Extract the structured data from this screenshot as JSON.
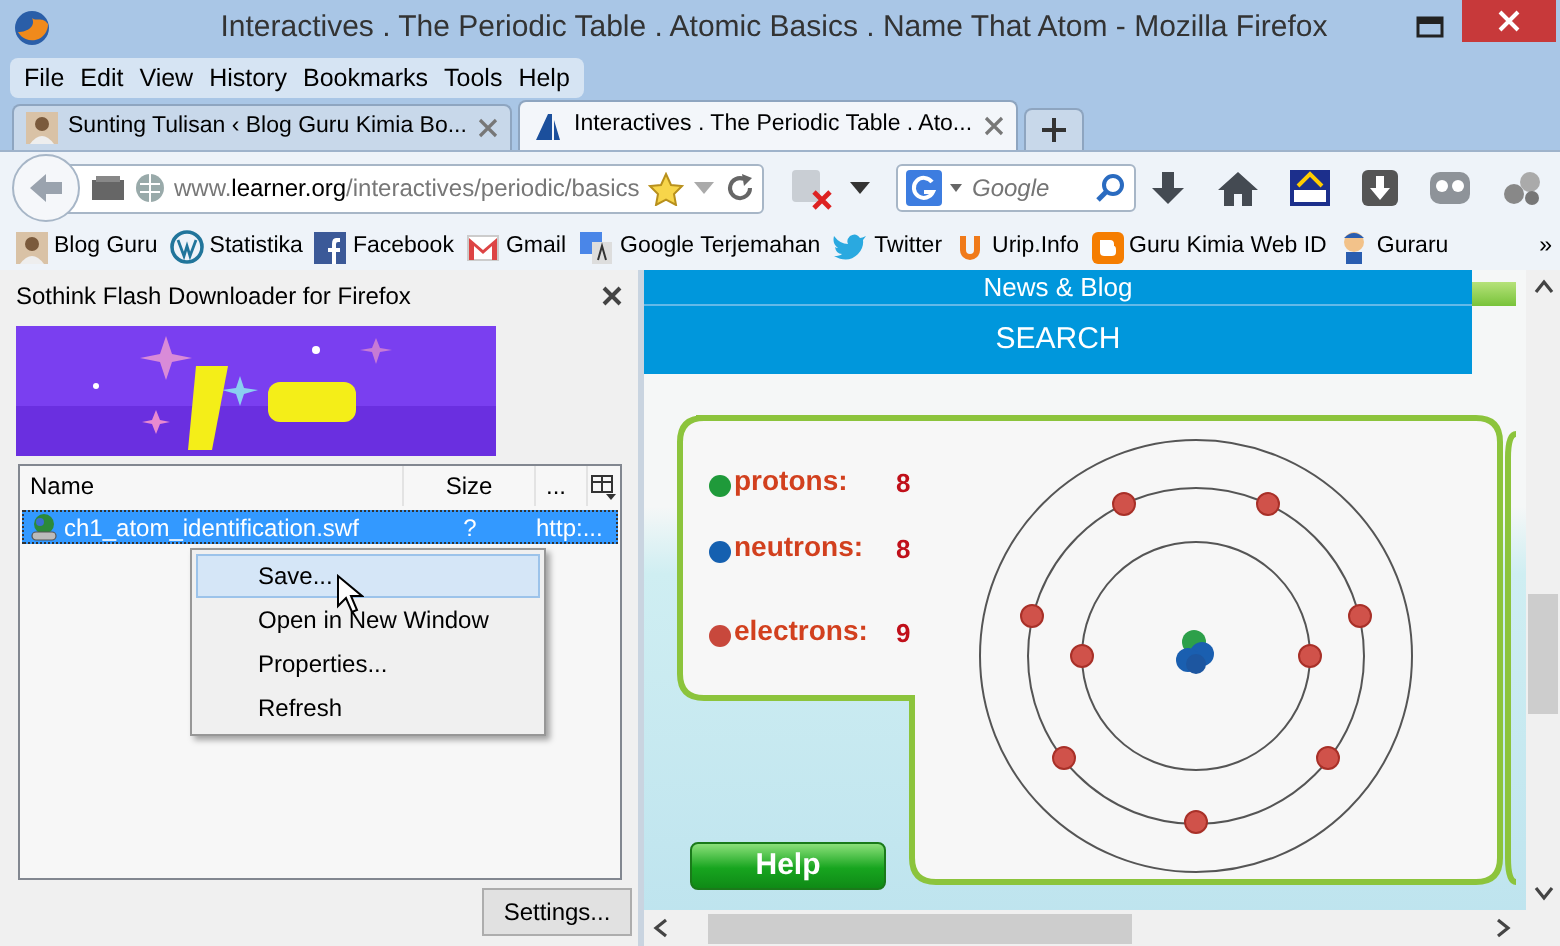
{
  "window": {
    "title": "Interactives . The Periodic Table . Atomic Basics . Name That Atom - Mozilla Firefox"
  },
  "menu": [
    "File",
    "Edit",
    "View",
    "History",
    "Bookmarks",
    "Tools",
    "Help"
  ],
  "tabs": [
    {
      "label": "Sunting Tulisan ‹ Blog Guru Kimia Bo...",
      "selected": false
    },
    {
      "label": "Interactives . The Periodic Table . Ato...",
      "selected": true
    }
  ],
  "address": {
    "prefix": "www.",
    "host": "learner.org",
    "path": "/interactives/periodic/basics"
  },
  "search": {
    "placeholder": "Google"
  },
  "bookmarks": {
    "items": [
      "Blog Guru",
      "Statistika",
      "Facebook",
      "Gmail",
      "Google Terjemahan",
      "Twitter",
      "Urip.Info",
      "Guru Kimia Web ID",
      "Guraru"
    ],
    "overflow": "»"
  },
  "sidebar": {
    "title": "Sothink Flash Downloader for Firefox",
    "banner": {
      "kind": "picture"
    },
    "columns": [
      "Name",
      "Size",
      "..."
    ],
    "rows": [
      {
        "name": "ch1_atom_identification.swf",
        "size": "?",
        "url": "http:...",
        "selected": true
      }
    ],
    "context_menu": [
      {
        "label": "Save...",
        "selected": true
      },
      {
        "label": "Open in New Window",
        "selected": false
      },
      {
        "label": "Properties...",
        "selected": false
      },
      {
        "label": "Refresh",
        "selected": false
      }
    ],
    "settings_button": "Settings..."
  },
  "page": {
    "nav": [
      "News & Blog",
      "SEARCH"
    ],
    "particles": [
      {
        "label": "protons:",
        "value": "8",
        "color": "#1f9a3a"
      },
      {
        "label": "neutrons:",
        "value": "8",
        "color": "#1560b0"
      },
      {
        "label": "electrons:",
        "value": "9",
        "color": "#c8483c"
      }
    ],
    "help_button": "Help"
  }
}
